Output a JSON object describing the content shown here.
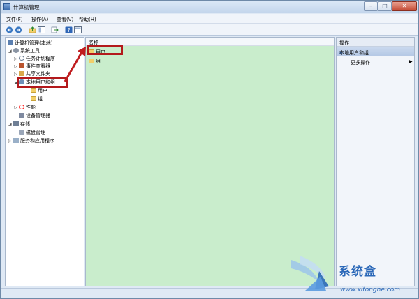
{
  "window": {
    "title": "计算机管理"
  },
  "menu": [
    "文件(F)",
    "操作(A)",
    "查看(V)",
    "帮助(H)"
  ],
  "toolbar": {
    "icons": [
      "back-arrow-icon",
      "forward-arrow-icon",
      "up-folder-icon",
      "show-hide-tree-icon",
      "export-icon",
      "help-icon",
      "properties-icon"
    ]
  },
  "tree": {
    "root": "计算机管理(本地)",
    "system_tools": "系统工具",
    "task_scheduler": "任务计划程序",
    "event_viewer": "事件查看器",
    "shared_folders": "共享文件夹",
    "local_users_groups": "本地用户和组",
    "users": "用户",
    "groups": "组",
    "performance": "性能",
    "device_manager": "设备管理器",
    "storage": "存储",
    "disk_management": "磁盘管理",
    "services_apps": "服务和应用程序"
  },
  "list": {
    "column_name": "名称",
    "items": [
      "用户",
      "组"
    ]
  },
  "actions": {
    "title": "操作",
    "section": "本地用户和组",
    "more": "更多操作"
  },
  "watermark": {
    "brand": "系统盒",
    "url": "www.xitonghe.com"
  },
  "colors": {
    "highlight": "#b3191c",
    "list_bg": "#c9edcc"
  }
}
